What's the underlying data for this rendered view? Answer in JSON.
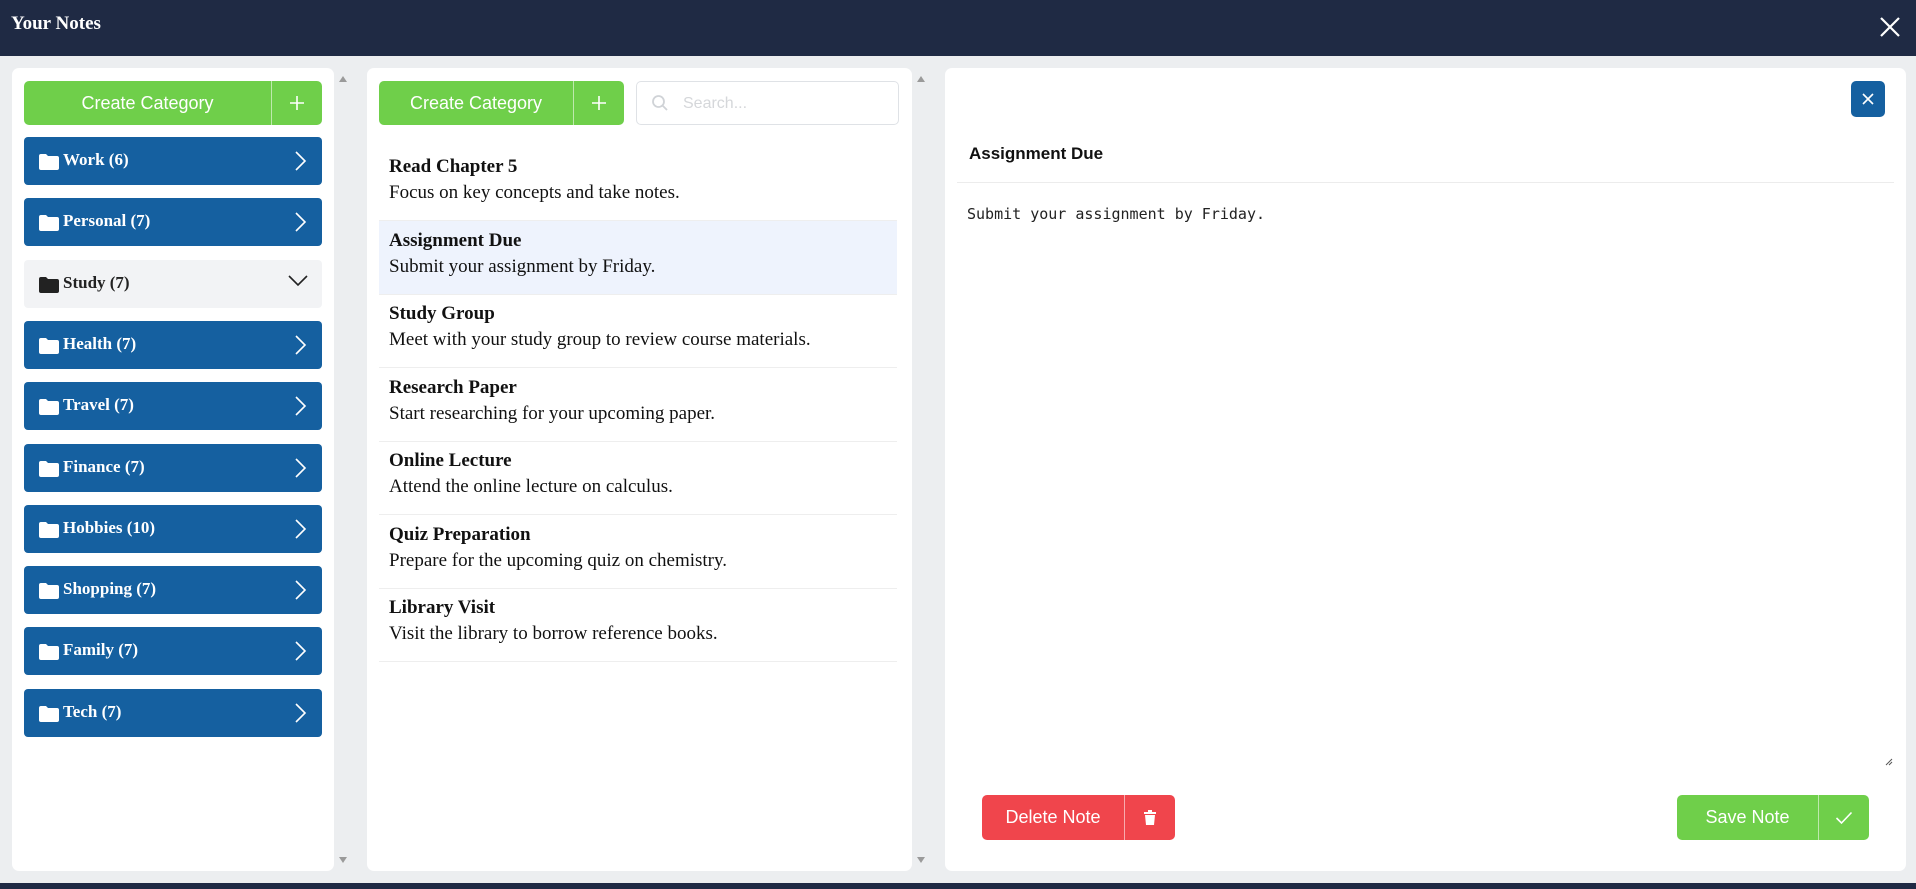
{
  "window": {
    "title": "Your Notes"
  },
  "categories_panel": {
    "create_label": "Create Category",
    "items": [
      {
        "label": "Work (6)",
        "state": "collapsed"
      },
      {
        "label": "Personal (7)",
        "state": "collapsed"
      },
      {
        "label": "Study (7)",
        "state": "expanded"
      },
      {
        "label": "Health (7)",
        "state": "collapsed"
      },
      {
        "label": "Travel (7)",
        "state": "collapsed"
      },
      {
        "label": "Finance (7)",
        "state": "collapsed"
      },
      {
        "label": "Hobbies (10)",
        "state": "collapsed"
      },
      {
        "label": "Shopping (7)",
        "state": "collapsed"
      },
      {
        "label": "Family (7)",
        "state": "collapsed"
      },
      {
        "label": "Tech (7)",
        "state": "collapsed"
      }
    ]
  },
  "notes_panel": {
    "create_label": "Create Category",
    "search_placeholder": "Search...",
    "notes": [
      {
        "title": "Read Chapter 5",
        "body": "Focus on key concepts and take notes."
      },
      {
        "title": "Assignment Due",
        "body": "Submit your assignment by Friday.",
        "selected": true
      },
      {
        "title": "Study Group",
        "body": "Meet with your study group to review course materials."
      },
      {
        "title": "Research Paper",
        "body": "Start researching for your upcoming paper."
      },
      {
        "title": "Online Lecture",
        "body": "Attend the online lecture on calculus."
      },
      {
        "title": "Quiz Preparation",
        "body": "Prepare for the upcoming quiz on chemistry."
      },
      {
        "title": "Library Visit",
        "body": "Visit the library to borrow reference books."
      }
    ]
  },
  "editor": {
    "title": "Assignment Due",
    "body": "Submit your assignment by Friday.",
    "delete_label": "Delete Note",
    "save_label": "Save Note"
  },
  "colors": {
    "titlebar": "#1f2a44",
    "category_blue": "#1560a0",
    "green": "#6fcf4a",
    "red": "#f0454c",
    "selected_note": "#eef3fd"
  }
}
